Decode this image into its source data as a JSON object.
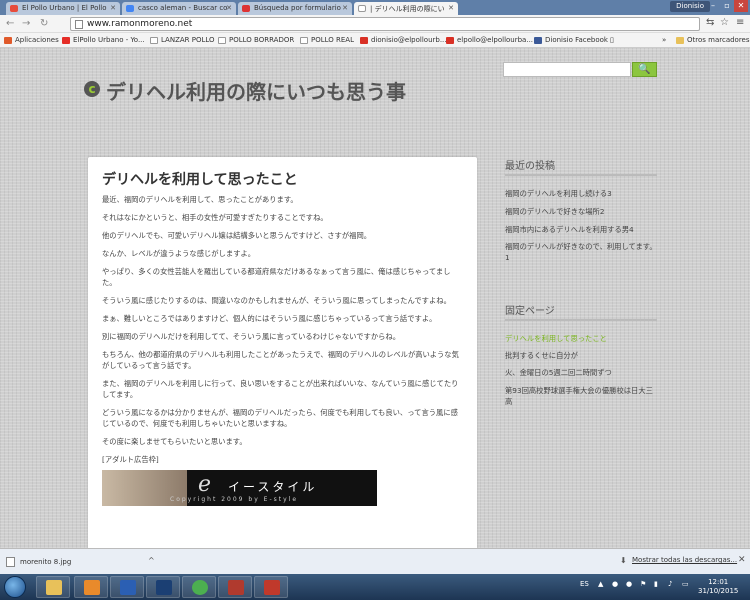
{
  "browser": {
    "tabs": [
      {
        "label": "El Pollo Urbano | El Pollo",
        "color": "#e74c3c",
        "active": false
      },
      {
        "label": "casco aleman - Buscar co",
        "color": "#4285f4",
        "active": false
      },
      {
        "label": "Búsqueda por formulario",
        "color": "#d33",
        "active": false
      },
      {
        "label": "| デリヘル利用の際にい",
        "color": "#ffffff",
        "active": true
      }
    ],
    "user": "Dionisio",
    "url": "www.ramonmoreno.net",
    "bookmarks": [
      {
        "label": "Aplicaciones",
        "color": "#e05a2b"
      },
      {
        "label": "ElPollo Urbano - Yo...",
        "color": "#e52d27"
      },
      {
        "label": "LANZAR POLLO",
        "color": "#ffffff"
      },
      {
        "label": "POLLO BORRADOR",
        "color": "#ffffff"
      },
      {
        "label": "POLLO REAL",
        "color": "#ffffff"
      },
      {
        "label": "dionisio@elpollourb...",
        "color": "#d93025"
      },
      {
        "label": "elpollo@elpollourba...",
        "color": "#d93025"
      },
      {
        "label": "Dionisio Facebook",
        "color": "#3b5998"
      }
    ],
    "bookmarks_more": "»",
    "other_bookmarks": "Otros marcadores"
  },
  "site": {
    "title": "デリヘル利用の際にいつも思う事",
    "search_button": "🔍"
  },
  "post": {
    "title": "デリヘルを利用して思ったこと",
    "paragraphs": [
      "最近、福岡のデリヘルを利用して、思ったことがあります。",
      "それはなにかというと、相手の女性が可愛すぎたりすることですね。",
      "他のデリヘルでも、可愛いデリヘル嬢は結構多いと思うんですけど、さすが福岡。",
      "なんか、レベルが違うような感じがしますよ。",
      "やっぱり、多くの女性芸能人を羅出している都道府県なだけあるなぁって言う風に、俺は感じちゃってました。",
      "そういう風に感じたりするのは、間違いなのかもしれませんが、そういう風に思ってしまったんですよね。",
      "まぁ、難しいところではありますけど、個人的にはそういう風に感じちゃっているって言う話ですよ。",
      "別に福岡のデリヘルだけを利用してて、そういう風に言っているわけじゃないですからね。",
      "もちろん、他の都道府県のデリヘルも利用したことがあったうえで、福岡のデリヘルのレベルが高いような気がしているって言う話です。",
      "また、福岡のデリヘルを利用しに行って、良い思いをすることが出来ればいいな、なんていう風に感じてたりしてます。",
      "どういう風になるかは分かりませんが、福岡のデリヘルだったら、何度でも利用しても良い、って言う風に感じているので、何度でも利用しちゃいたいと思いますね。",
      "その度に楽しませてもらいたいと思います。",
      "[アダルト広告枠]"
    ],
    "ad": {
      "logo": "e",
      "name": "イースタイル",
      "copyright": "Copyright 2009 by E-style"
    }
  },
  "sidebar": {
    "recent_heading": "最近の投稿",
    "recent": [
      "福岡のデリヘルを利用し続ける3",
      "福岡のデリヘルで好きな場所2",
      "福岡市内にあるデリヘルを利用する男4",
      "福岡のデリヘルが好きなので、利用してます。1"
    ],
    "pages_heading": "固定ページ",
    "pages": [
      {
        "label": "デリヘルを利用して思ったこと",
        "active": true
      },
      {
        "label": "批判するくせに自分が",
        "active": false
      },
      {
        "label": "火、金曜日の5週二回二時間ずつ",
        "active": false
      },
      {
        "label": "第93回高校野球選手権大会の優勝校は日大三高",
        "active": false
      }
    ]
  },
  "downloads": {
    "file": "morenito 8.jpg",
    "show_all": "Mostrar todas las descargas...",
    "close": "✕"
  },
  "taskbar": {
    "apps": [
      {
        "icon": "folder-icon",
        "color": "#e8c15a"
      },
      {
        "icon": "media-player-icon",
        "color": "#e98a2b"
      },
      {
        "icon": "word-icon",
        "color": "#2b5fb3"
      },
      {
        "icon": "photoshop-icon",
        "color": "#1b3f73"
      },
      {
        "icon": "chrome-icon",
        "color": "#4caf50"
      },
      {
        "icon": "game-icon",
        "color": "#b03a2e"
      },
      {
        "icon": "acrobat-icon",
        "color": "#c0392b"
      }
    ],
    "language": "ES",
    "time": "12:01",
    "date": "31/10/2015"
  }
}
